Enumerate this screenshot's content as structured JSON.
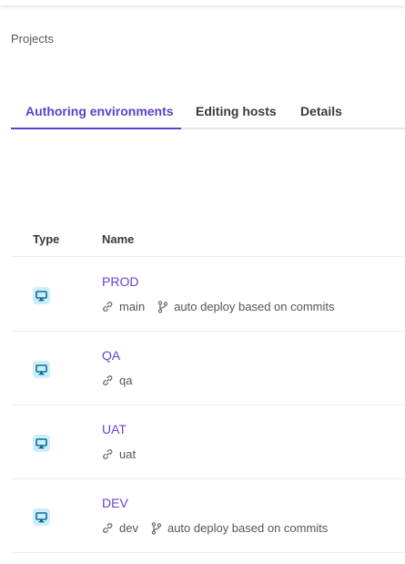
{
  "breadcrumb": "Projects",
  "tabs": [
    {
      "label": "Authoring environments",
      "active": true
    },
    {
      "label": "Editing hosts",
      "active": false
    },
    {
      "label": "Details",
      "active": false
    }
  ],
  "table": {
    "headers": {
      "type": "Type",
      "name": "Name"
    },
    "rows": [
      {
        "type_icon": "monitor-icon",
        "name": "PROD",
        "branch": "main",
        "deploy": "auto deploy based on commits"
      },
      {
        "type_icon": "monitor-icon",
        "name": "QA",
        "branch": "qa",
        "deploy": ""
      },
      {
        "type_icon": "monitor-icon",
        "name": "UAT",
        "branch": "uat",
        "deploy": ""
      },
      {
        "type_icon": "monitor-icon",
        "name": "DEV",
        "branch": "dev",
        "deploy": "auto deploy based on commits"
      }
    ]
  },
  "colors": {
    "accent": "#5b3fc8",
    "link": "#6a3fd6",
    "icon_bg": "#cdeefa",
    "icon_fg": "#0b6e9c"
  }
}
